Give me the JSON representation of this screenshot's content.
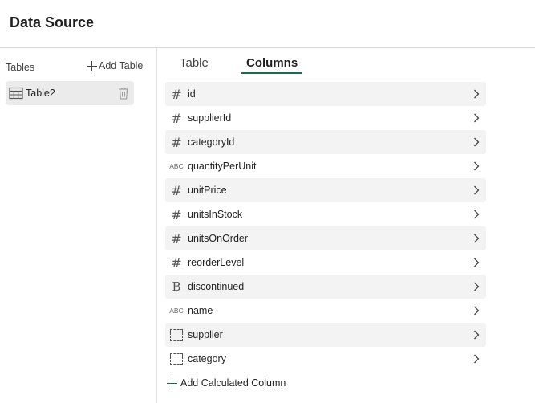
{
  "header": {
    "title": "Data Source"
  },
  "sidebar": {
    "tables_label": "Tables",
    "add_table_label": "Add Table",
    "tables": [
      {
        "name": "Table2"
      }
    ]
  },
  "tabs": [
    {
      "label": "Table",
      "active": false
    },
    {
      "label": "Columns",
      "active": true
    }
  ],
  "columns": [
    {
      "name": "id",
      "type": "number",
      "icon": "hash-icon"
    },
    {
      "name": "supplierId",
      "type": "number",
      "icon": "hash-icon"
    },
    {
      "name": "categoryId",
      "type": "number",
      "icon": "hash-icon"
    },
    {
      "name": "quantityPerUnit",
      "type": "text",
      "icon": "abc-icon",
      "icon_text": "ABC"
    },
    {
      "name": "unitPrice",
      "type": "number",
      "icon": "hash-icon"
    },
    {
      "name": "unitsInStock",
      "type": "number",
      "icon": "hash-icon"
    },
    {
      "name": "unitsOnOrder",
      "type": "number",
      "icon": "hash-icon"
    },
    {
      "name": "reorderLevel",
      "type": "number",
      "icon": "hash-icon"
    },
    {
      "name": "discontinued",
      "type": "boolean",
      "icon": "boolean-icon",
      "icon_text": "B"
    },
    {
      "name": "name",
      "type": "text",
      "icon": "abc-icon",
      "icon_text": "ABC"
    },
    {
      "name": "supplier",
      "type": "object",
      "icon": "object-icon"
    },
    {
      "name": "category",
      "type": "object",
      "icon": "object-icon"
    }
  ],
  "add_calculated_label": "Add Calculated Column",
  "colors": {
    "accent": "#1b6b49",
    "row_shade": "#f3f3f3",
    "selected_table": "#ebebeb"
  }
}
